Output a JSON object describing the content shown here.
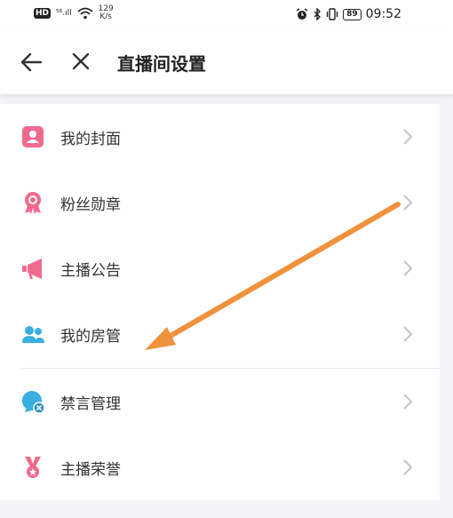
{
  "status_bar": {
    "hd": "HD",
    "network": "⁵⁶.ıll",
    "speed_value": "129",
    "speed_unit": "K/s",
    "battery": "89",
    "time": "09:52"
  },
  "header": {
    "title": "直播间设置",
    "back_icon": "back-arrow-icon",
    "close_icon": "close-icon"
  },
  "menu": {
    "items": [
      {
        "label": "我的封面",
        "icon": "cover-icon",
        "color": "#f06a8e"
      },
      {
        "label": "粉丝勋章",
        "icon": "medal-icon",
        "color": "#f06a8e"
      },
      {
        "label": "主播公告",
        "icon": "megaphone-icon",
        "color": "#f06a8e"
      },
      {
        "label": "我的房管",
        "icon": "users-icon",
        "color": "#3aaee0"
      },
      {
        "label": "禁言管理",
        "icon": "mute-chat-icon",
        "color": "#3aaee0"
      },
      {
        "label": "主播荣誉",
        "icon": "honor-badge-icon",
        "color": "#f06a8e"
      }
    ]
  },
  "annotation": {
    "color": "#f0923c"
  }
}
